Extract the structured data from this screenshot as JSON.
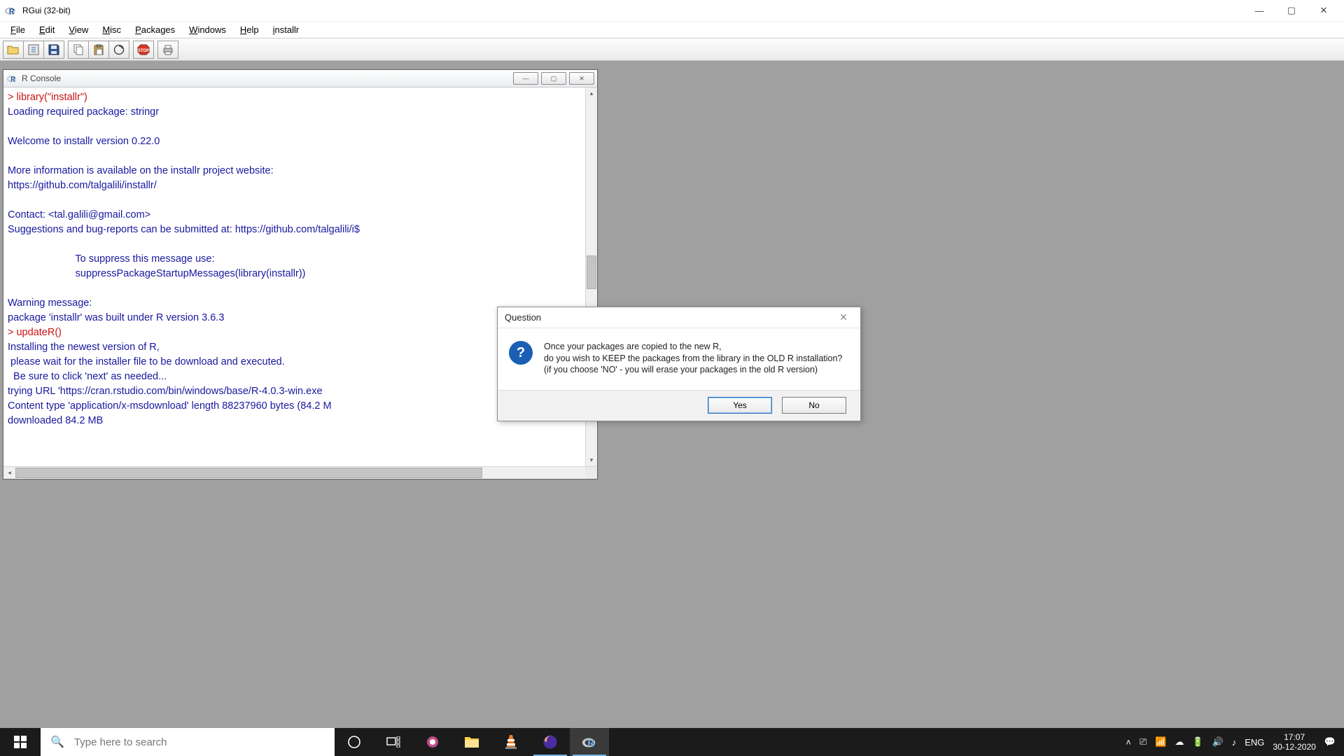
{
  "app": {
    "title": "RGui (32-bit)"
  },
  "menu": {
    "file": "File",
    "edit": "Edit",
    "view": "View",
    "misc": "Misc",
    "packages": "Packages",
    "windows": "Windows",
    "help": "Help",
    "installr": "installr"
  },
  "console": {
    "title": "R Console",
    "lines": {
      "l1": "> library(\"installr\")",
      "l2": "Loading required package: stringr",
      "l3": "",
      "l4": "Welcome to installr version 0.22.0",
      "l5": "",
      "l6": "More information is available on the installr project website:",
      "l7": "https://github.com/talgalili/installr/",
      "l8": "",
      "l9": "Contact: <tal.galili@gmail.com>",
      "l10": "Suggestions and bug-reports can be submitted at: https://github.com/talgalili/i$",
      "l11": "",
      "l12": "                        To suppress this message use:",
      "l13": "                        suppressPackageStartupMessages(library(installr))",
      "l14": "",
      "l15": "Warning message:",
      "l16": "package 'installr' was built under R version 3.6.3 ",
      "l17": "> updateR()",
      "l18": "Installing the newest version of R,",
      "l19": " please wait for the installer file to be download and executed.",
      "l20": "  Be sure to click 'next' as needed...",
      "l21": "trying URL 'https://cran.rstudio.com/bin/windows/base/R-4.0.3-win.exe",
      "l22": "Content type 'application/x-msdownload' length 88237960 bytes (84.2 M",
      "l23": "downloaded 84.2 MB",
      "l24": ""
    }
  },
  "dialog": {
    "title": "Question",
    "line1": "Once your packages are copied to the new R,",
    "line2": "do you wish to KEEP the packages from the library in the OLD R installation?",
    "line3": "(if you choose 'NO' - you will erase your packages in the old R version)",
    "yes": "Yes",
    "no": "No"
  },
  "taskbar": {
    "search_placeholder": "Type here to search",
    "lang": "ENG",
    "time": "17:07",
    "date": "30-12-2020"
  }
}
